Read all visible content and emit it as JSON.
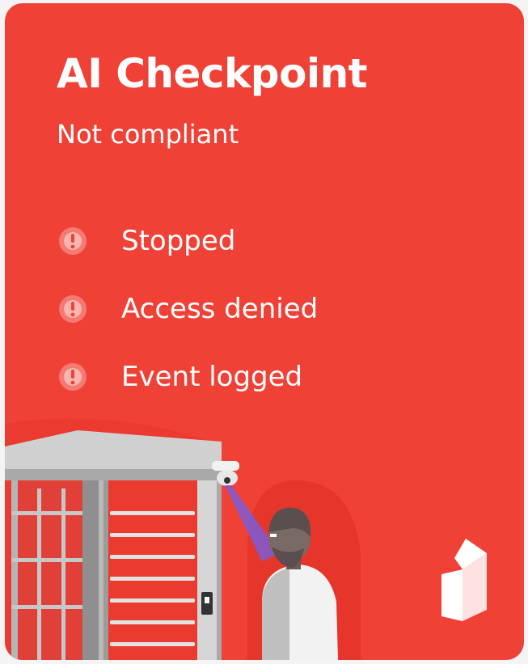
{
  "card": {
    "title": "AI Checkpoint",
    "subtitle": "Not compliant",
    "status_items": [
      {
        "label": "Stopped",
        "icon": "alert-icon"
      },
      {
        "label": "Access denied",
        "icon": "alert-icon"
      },
      {
        "label": "Event logged",
        "icon": "alert-icon"
      }
    ],
    "illustration": "turnstile-checkpoint",
    "logo": "brand-logo"
  },
  "colors": {
    "background": "#f04136",
    "text": "#ffffff",
    "turnstile_frame": "#c9c9c9",
    "bar": "#e3e3e3",
    "person_shirt": "#f2f2f2",
    "scan_beam": "#7b5cd6"
  }
}
